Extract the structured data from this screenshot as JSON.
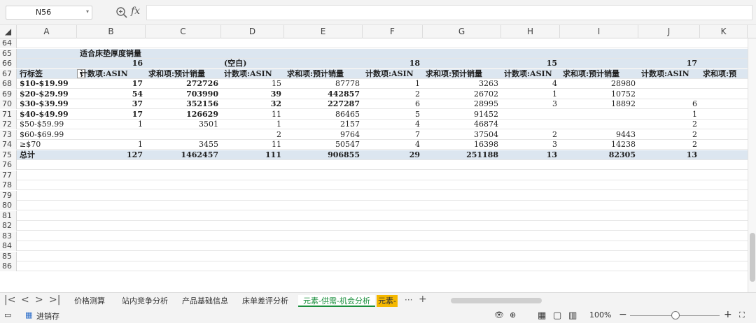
{
  "formula_bar": {
    "name_box": "N56",
    "fx_label": "fx",
    "formula": ""
  },
  "columns": [
    "A",
    "B",
    "C",
    "D",
    "E",
    "F",
    "G",
    "H",
    "I",
    "J",
    "K"
  ],
  "rows": [
    {
      "num": "64",
      "cells": []
    },
    {
      "num": "65",
      "band": true,
      "cells": [
        {
          "col": "B",
          "text": "适合床垫厚度销量",
          "bold": true
        }
      ]
    },
    {
      "num": "66",
      "band": true,
      "cells": [
        {
          "col": "B",
          "text": "16",
          "bold": true,
          "align": "r"
        },
        {
          "col": "D",
          "text": "(空白)",
          "bold": true
        },
        {
          "col": "F",
          "text": "18",
          "bold": true,
          "align": "r"
        },
        {
          "col": "H",
          "text": "15",
          "bold": true,
          "align": "r"
        },
        {
          "col": "J",
          "text": "17",
          "bold": true,
          "align": "r"
        }
      ]
    },
    {
      "num": "67",
      "band": true,
      "cells": [
        {
          "col": "A",
          "text": "行标签",
          "bold": true
        },
        {
          "col": "B",
          "text": "计数项:ASIN",
          "bold": true
        },
        {
          "col": "C",
          "text": "求和项:预计销量",
          "bold": true
        },
        {
          "col": "D",
          "text": "计数项:ASIN",
          "bold": true
        },
        {
          "col": "E",
          "text": "求和项:预计销量",
          "bold": true
        },
        {
          "col": "F",
          "text": "计数项:ASIN",
          "bold": true
        },
        {
          "col": "G",
          "text": "求和项:预计销量",
          "bold": true
        },
        {
          "col": "H",
          "text": "计数项:ASIN",
          "bold": true
        },
        {
          "col": "I",
          "text": "求和项:预计销量",
          "bold": true
        },
        {
          "col": "J",
          "text": "计数项:ASIN",
          "bold": true
        },
        {
          "col": "K",
          "text": "求和项:预",
          "bold": true
        }
      ]
    },
    {
      "num": "68",
      "cells": [
        {
          "col": "A",
          "text": "$10-$19.99",
          "bold": true
        },
        {
          "col": "B",
          "text": "17",
          "bold": true,
          "align": "r"
        },
        {
          "col": "C",
          "text": "272726",
          "bold": true,
          "align": "r"
        },
        {
          "col": "D",
          "text": "15",
          "align": "r"
        },
        {
          "col": "E",
          "text": "87778",
          "align": "r"
        },
        {
          "col": "F",
          "text": "1",
          "align": "r"
        },
        {
          "col": "G",
          "text": "3263",
          "align": "r"
        },
        {
          "col": "H",
          "text": "4",
          "align": "r"
        },
        {
          "col": "I",
          "text": "28980",
          "align": "r"
        }
      ]
    },
    {
      "num": "69",
      "cells": [
        {
          "col": "A",
          "text": "$20-$29.99",
          "bold": true
        },
        {
          "col": "B",
          "text": "54",
          "bold": true,
          "align": "r"
        },
        {
          "col": "C",
          "text": "703990",
          "bold": true,
          "align": "r"
        },
        {
          "col": "D",
          "text": "39",
          "bold": true,
          "align": "r"
        },
        {
          "col": "E",
          "text": "442857",
          "bold": true,
          "align": "r"
        },
        {
          "col": "F",
          "text": "2",
          "align": "r"
        },
        {
          "col": "G",
          "text": "26702",
          "align": "r"
        },
        {
          "col": "H",
          "text": "1",
          "align": "r"
        },
        {
          "col": "I",
          "text": "10752",
          "align": "r"
        }
      ]
    },
    {
      "num": "70",
      "cells": [
        {
          "col": "A",
          "text": "$30-$39.99",
          "bold": true
        },
        {
          "col": "B",
          "text": "37",
          "bold": true,
          "align": "r"
        },
        {
          "col": "C",
          "text": "352156",
          "bold": true,
          "align": "r"
        },
        {
          "col": "D",
          "text": "32",
          "bold": true,
          "align": "r"
        },
        {
          "col": "E",
          "text": "227287",
          "bold": true,
          "align": "r"
        },
        {
          "col": "F",
          "text": "6",
          "align": "r"
        },
        {
          "col": "G",
          "text": "28995",
          "align": "r"
        },
        {
          "col": "H",
          "text": "3",
          "align": "r"
        },
        {
          "col": "I",
          "text": "18892",
          "align": "r"
        },
        {
          "col": "J",
          "text": "6",
          "align": "r"
        }
      ]
    },
    {
      "num": "71",
      "cells": [
        {
          "col": "A",
          "text": "$40-$49.99",
          "bold": true
        },
        {
          "col": "B",
          "text": "17",
          "bold": true,
          "align": "r"
        },
        {
          "col": "C",
          "text": "126629",
          "bold": true,
          "align": "r"
        },
        {
          "col": "D",
          "text": "11",
          "align": "r"
        },
        {
          "col": "E",
          "text": "86465",
          "align": "r"
        },
        {
          "col": "F",
          "text": "5",
          "align": "r"
        },
        {
          "col": "G",
          "text": "91452",
          "align": "r"
        },
        {
          "col": "J",
          "text": "1",
          "align": "r"
        }
      ]
    },
    {
      "num": "72",
      "cells": [
        {
          "col": "A",
          "text": "$50-$59.99"
        },
        {
          "col": "B",
          "text": "1",
          "align": "r"
        },
        {
          "col": "C",
          "text": "3501",
          "align": "r"
        },
        {
          "col": "D",
          "text": "1",
          "align": "r"
        },
        {
          "col": "E",
          "text": "2157",
          "align": "r"
        },
        {
          "col": "F",
          "text": "4",
          "align": "r"
        },
        {
          "col": "G",
          "text": "46874",
          "align": "r"
        },
        {
          "col": "J",
          "text": "2",
          "align": "r"
        }
      ]
    },
    {
      "num": "73",
      "cells": [
        {
          "col": "A",
          "text": "$60-$69.99"
        },
        {
          "col": "D",
          "text": "2",
          "align": "r"
        },
        {
          "col": "E",
          "text": "9764",
          "align": "r"
        },
        {
          "col": "F",
          "text": "7",
          "align": "r"
        },
        {
          "col": "G",
          "text": "37504",
          "align": "r"
        },
        {
          "col": "H",
          "text": "2",
          "align": "r"
        },
        {
          "col": "I",
          "text": "9443",
          "align": "r"
        },
        {
          "col": "J",
          "text": "2",
          "align": "r"
        }
      ]
    },
    {
      "num": "74",
      "cells": [
        {
          "col": "A",
          "text": "≥$70"
        },
        {
          "col": "B",
          "text": "1",
          "align": "r"
        },
        {
          "col": "C",
          "text": "3455",
          "align": "r"
        },
        {
          "col": "D",
          "text": "11",
          "align": "r"
        },
        {
          "col": "E",
          "text": "50547",
          "align": "r"
        },
        {
          "col": "F",
          "text": "4",
          "align": "r"
        },
        {
          "col": "G",
          "text": "16398",
          "align": "r"
        },
        {
          "col": "H",
          "text": "3",
          "align": "r"
        },
        {
          "col": "I",
          "text": "14238",
          "align": "r"
        },
        {
          "col": "J",
          "text": "2",
          "align": "r"
        }
      ]
    },
    {
      "num": "75",
      "band": true,
      "cells": [
        {
          "col": "A",
          "text": "总计",
          "bold": true
        },
        {
          "col": "B",
          "text": "127",
          "bold": true,
          "align": "r"
        },
        {
          "col": "C",
          "text": "1462457",
          "bold": true,
          "align": "r"
        },
        {
          "col": "D",
          "text": "111",
          "bold": true,
          "align": "r"
        },
        {
          "col": "E",
          "text": "906855",
          "bold": true,
          "align": "r"
        },
        {
          "col": "F",
          "text": "29",
          "bold": true,
          "align": "r"
        },
        {
          "col": "G",
          "text": "251188",
          "bold": true,
          "align": "r"
        },
        {
          "col": "H",
          "text": "13",
          "bold": true,
          "align": "r"
        },
        {
          "col": "I",
          "text": "82305",
          "bold": true,
          "align": "r"
        },
        {
          "col": "J",
          "text": "13",
          "bold": true,
          "align": "r"
        }
      ]
    },
    {
      "num": "76",
      "cells": []
    },
    {
      "num": "77",
      "cells": []
    },
    {
      "num": "78",
      "cells": []
    },
    {
      "num": "79",
      "cells": []
    },
    {
      "num": "80",
      "cells": []
    },
    {
      "num": "81",
      "cells": []
    },
    {
      "num": "82",
      "cells": []
    },
    {
      "num": "83",
      "cells": []
    },
    {
      "num": "84",
      "cells": []
    },
    {
      "num": "85",
      "cells": []
    },
    {
      "num": "86",
      "cells": []
    }
  ],
  "sheet_tabs": [
    {
      "label": "价格测算",
      "active": false
    },
    {
      "label": "站内竞争分析",
      "active": false
    },
    {
      "label": "产品基础信息",
      "active": false
    },
    {
      "label": "床单差评分析",
      "active": false
    },
    {
      "label": "元素-供需-机会分析",
      "active": true
    },
    {
      "label": "元素-",
      "active": false,
      "partial": true
    }
  ],
  "tab_more": "···",
  "tab_add": "+",
  "status_bar": {
    "macro_label": "进销存",
    "zoom": "100%"
  },
  "colors": {
    "band": "#dce6f0",
    "active_tab": "#1a8f3c",
    "partial_tab": "#f5b800"
  }
}
